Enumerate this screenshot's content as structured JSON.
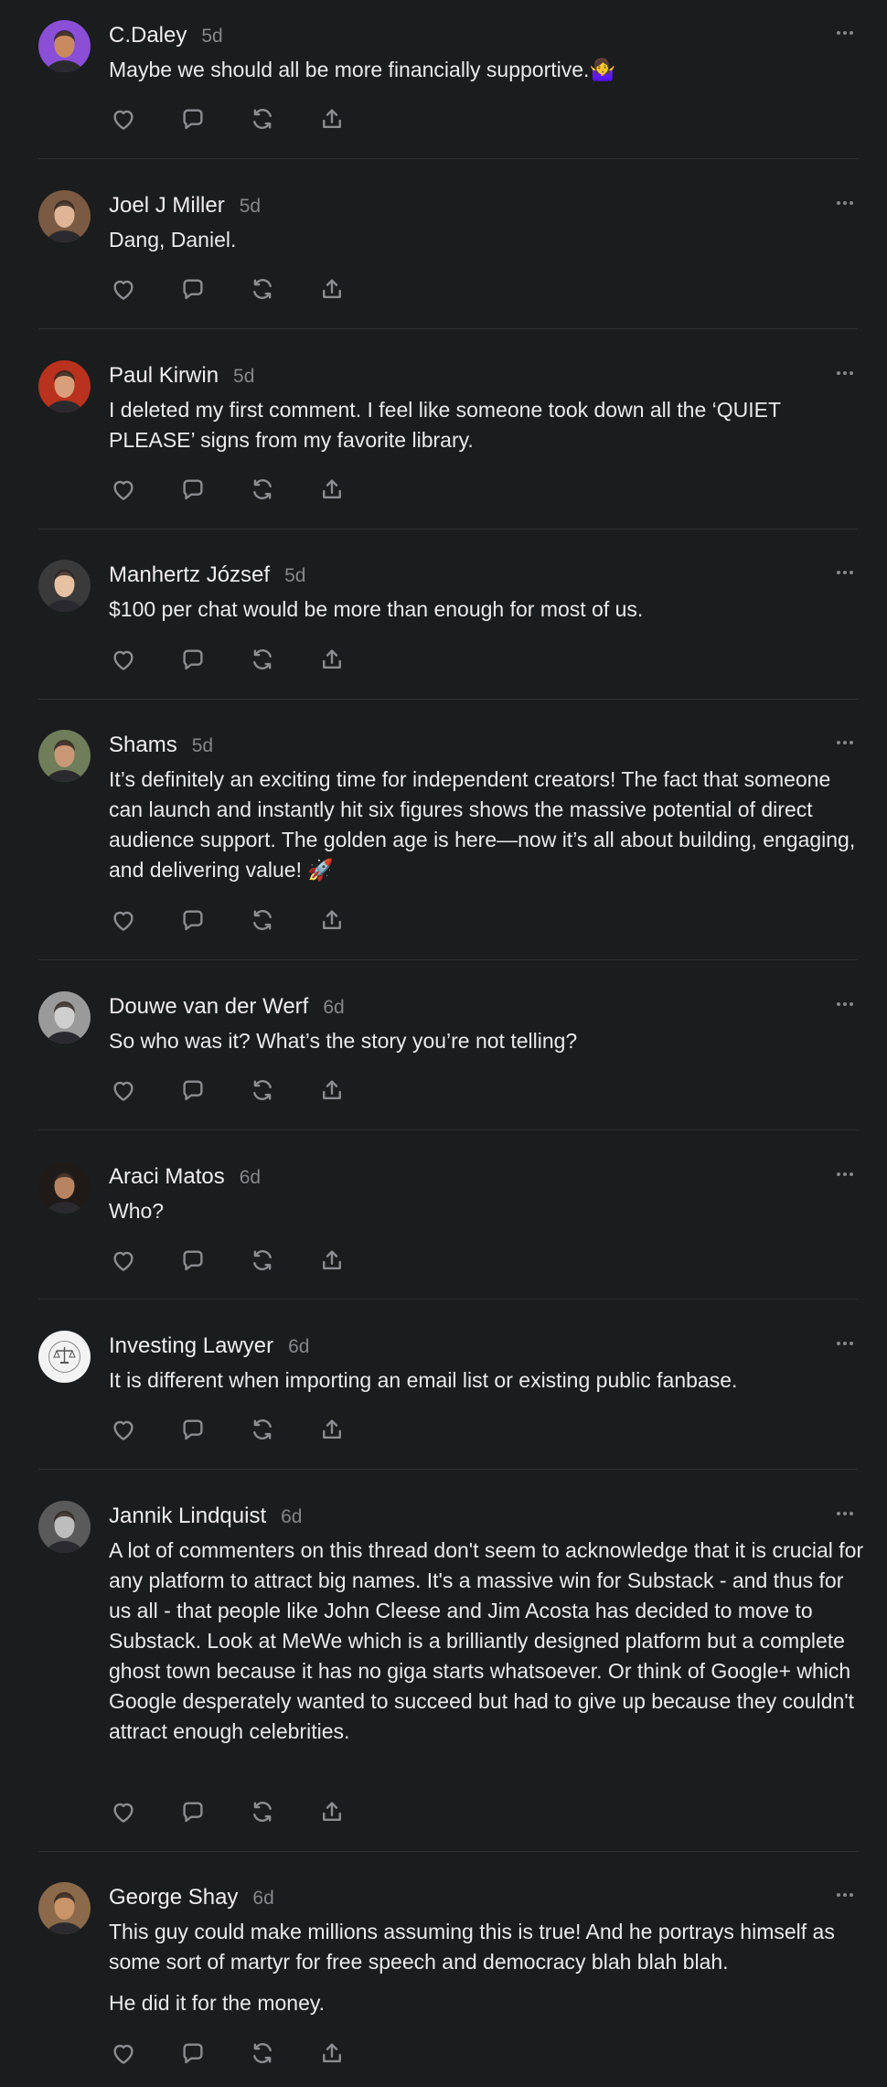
{
  "comments": [
    {
      "name": "C.Daley",
      "time": "5d",
      "paragraphs": [
        "Maybe we should all be more financially supportive.🤷‍♀️"
      ],
      "avatar_icon": "avatar-woman-icon",
      "avatar_bg": "#8a4fd6"
    },
    {
      "name": "Joel J Miller",
      "time": "5d",
      "paragraphs": [
        "Dang, Daniel."
      ],
      "avatar_icon": "avatar-man-glasses-icon",
      "avatar_bg": "#7a5a43"
    },
    {
      "name": "Paul Kirwin",
      "time": "5d",
      "paragraphs": [
        "I deleted my first comment. I feel like someone took down all the ‘QUIET PLEASE’ signs from my favorite library."
      ],
      "avatar_icon": "avatar-abstract-icon",
      "avatar_bg": "#b8321e"
    },
    {
      "name": "Manhertz József",
      "time": "5d",
      "paragraphs": [
        "$100 per chat would be more than enough for most of us."
      ],
      "avatar_icon": "avatar-man-icon",
      "avatar_bg": "#3a3a3a"
    },
    {
      "name": "Shams",
      "time": "5d",
      "paragraphs": [
        "It’s definitely an exciting time for independent creators! The fact that someone can launch and instantly hit six figures shows the massive potential of direct audience support. The golden age is here—now it’s all about building, engaging, and delivering value! 🚀"
      ],
      "avatar_icon": "avatar-man-outdoor-icon",
      "avatar_bg": "#6f7d5a"
    },
    {
      "name": "Douwe van der Werf",
      "time": "6d",
      "paragraphs": [
        "So who was it? What’s the story you’re not telling?"
      ],
      "avatar_icon": "avatar-man-bw-icon",
      "avatar_bg": "#9a9a9a"
    },
    {
      "name": "Araci Matos",
      "time": "6d",
      "paragraphs": [
        "Who?"
      ],
      "avatar_icon": "avatar-woman-dark-icon",
      "avatar_bg": "#1e1a18"
    },
    {
      "name": "Investing Lawyer",
      "time": "6d",
      "paragraphs": [
        "It is different when importing an email list or existing public fanbase."
      ],
      "avatar_icon": "avatar-scales-logo-icon",
      "avatar_bg": "#f3f3f3"
    },
    {
      "name": "Jannik Lindquist",
      "time": "6d",
      "paragraphs": [
        "A lot of commenters on this thread don't seem to acknowledge that it is crucial for any platform to attract big names. It's a massive win for Substack - and thus for us all - that people like John Cleese and Jim Acosta has decided to move to Substack. Look at MeWe which is a brilliantly designed platform but a complete ghost town because it has no giga starts whatsoever. Or think of Google+ which Google desperately wanted to succeed but had to give up because they couldn't attract enough celebrities."
      ],
      "avatar_icon": "avatar-man-bw-icon",
      "avatar_bg": "#5a5a5a"
    },
    {
      "name": "George Shay",
      "time": "6d",
      "paragraphs": [
        "This guy could make millions assuming this is true! And he portrays himself as some sort of martyr for free speech and democracy blah blah blah.",
        "He did it for the money."
      ],
      "avatar_icon": "avatar-man-painting-icon",
      "avatar_bg": "#8a6a4a"
    }
  ],
  "actions": [
    "like-icon",
    "reply-icon",
    "restack-icon",
    "share-icon"
  ],
  "colors": {
    "background": "#1b1c1e",
    "divider": "#2e2f33",
    "muted": "#86878b",
    "text": "#ecebeb"
  }
}
